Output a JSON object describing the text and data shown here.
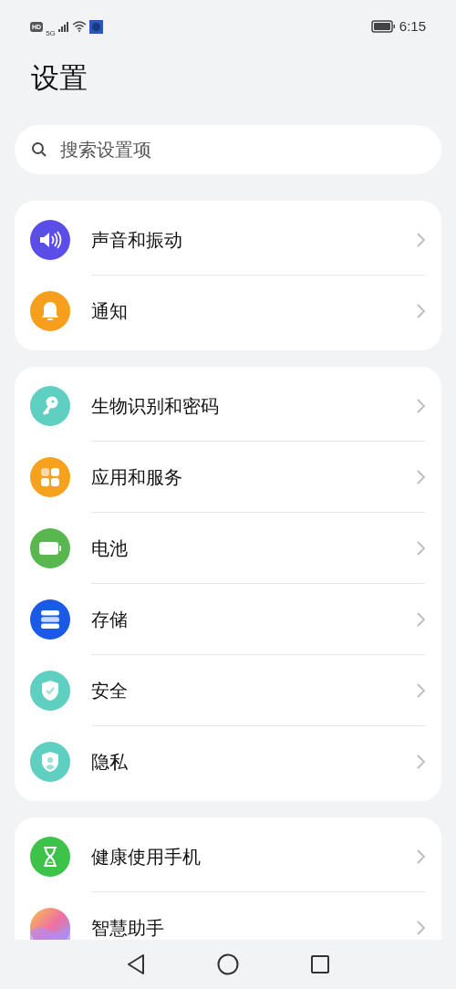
{
  "status_bar": {
    "hd": "HD",
    "network": "5G",
    "time": "6:15"
  },
  "title": "设置",
  "search": {
    "placeholder": "搜索设置项"
  },
  "groups": [
    {
      "items": [
        {
          "label": "声音和振动",
          "kind": "speaker",
          "color": "#5b4ee8"
        },
        {
          "label": "通知",
          "kind": "bell",
          "color": "#f59f1c"
        }
      ]
    },
    {
      "items": [
        {
          "label": "生物识别和密码",
          "kind": "key",
          "color": "#5ecfc0"
        },
        {
          "label": "应用和服务",
          "kind": "apps",
          "color": "#f7a21f"
        },
        {
          "label": "电池",
          "kind": "battery",
          "color": "#58b84f"
        },
        {
          "label": "存储",
          "kind": "storage",
          "color": "#1a5ae6"
        },
        {
          "label": "安全",
          "kind": "shield",
          "color": "#5ecfc0"
        },
        {
          "label": "隐私",
          "kind": "privacy",
          "color": "#5ecfc0"
        }
      ]
    },
    {
      "items": [
        {
          "label": "健康使用手机",
          "kind": "hourglass",
          "color": "#3dc24a"
        },
        {
          "label": "智慧助手",
          "kind": "assistant"
        }
      ]
    }
  ]
}
